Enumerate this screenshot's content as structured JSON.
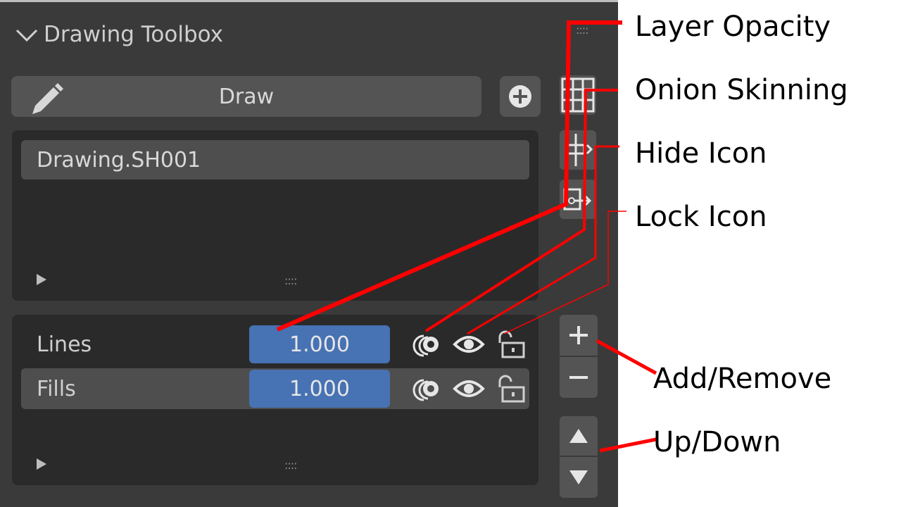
{
  "panel": {
    "header_title": "Drawing Toolbox",
    "tool_label": "Draw",
    "selected_object": "Drawing.SH001",
    "layers": [
      {
        "name": "Lines",
        "opacity": "1.000"
      },
      {
        "name": "Fills",
        "opacity": "1.000"
      }
    ],
    "grip": "::::"
  },
  "annotations": {
    "layer_opacity": "Layer Opacity",
    "onion_skinning": "Onion Skinning",
    "hide_icon": "Hide Icon",
    "lock_icon": "Lock Icon",
    "add_remove": "Add/Remove",
    "up_down": "Up/Down"
  },
  "colors": {
    "panel_bg": "#3a3a3a",
    "button_bg": "#545454",
    "value_field": "#4772b3",
    "annotation_line": "#ff0000"
  }
}
